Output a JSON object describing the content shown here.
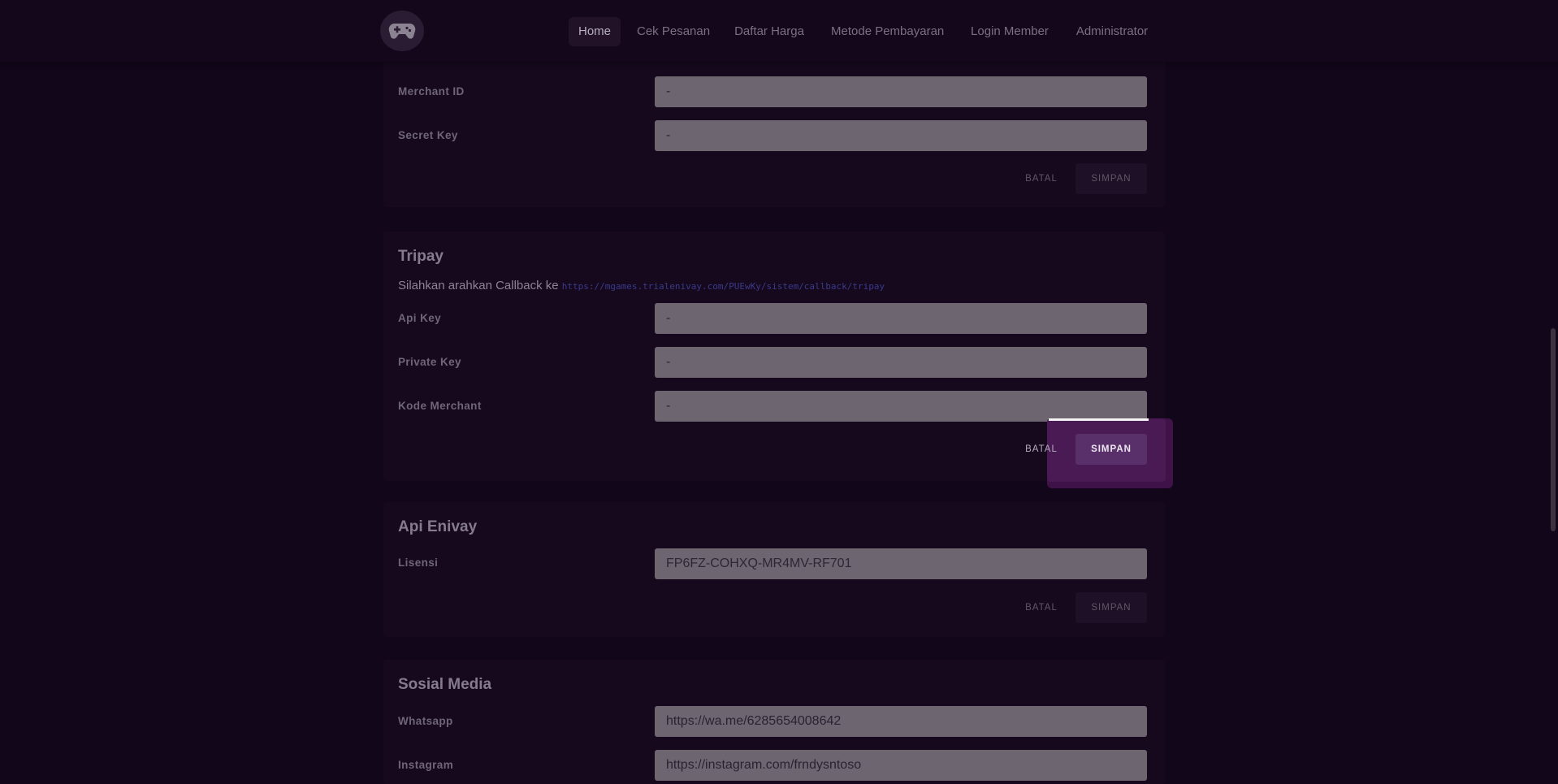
{
  "nav": {
    "logo_icon": "gamepad-icon",
    "items": [
      {
        "label": "Home",
        "active": true
      },
      {
        "label": "Cek Pesanan",
        "active": false
      },
      {
        "label": "Daftar Harga",
        "active": false
      },
      {
        "label": "Metode Pembayaran",
        "active": false
      },
      {
        "label": "Login Member",
        "active": false
      },
      {
        "label": "Administrator",
        "active": false
      }
    ]
  },
  "gateway_top": {
    "fields": [
      {
        "label": "Merchant ID",
        "value": "-"
      },
      {
        "label": "Secret Key",
        "value": "-"
      }
    ],
    "cancel_label": "BATAL",
    "save_label": "SIMPAN"
  },
  "tripay": {
    "title": "Tripay",
    "callback_text": "Silahkan arahkan Callback ke",
    "callback_url": "https://mgames.trialenivay.com/PUEwKy/sistem/callback/tripay",
    "fields": [
      {
        "label": "Api Key",
        "value": "-"
      },
      {
        "label": "Private Key",
        "value": "-"
      },
      {
        "label": "Kode Merchant",
        "value": "-"
      }
    ],
    "cancel_label": "BATAL",
    "save_label": "SIMPAN"
  },
  "api_enivay": {
    "title": "Api Enivay",
    "fields": [
      {
        "label": "Lisensi",
        "value": "FP6FZ-COHXQ-MR4MV-RF701"
      }
    ],
    "cancel_label": "BATAL",
    "save_label": "SIMPAN"
  },
  "sosial_media": {
    "title": "Sosial Media",
    "fields": [
      {
        "label": "Whatsapp",
        "value": "https://wa.me/6285654008642"
      },
      {
        "label": "Instagram",
        "value": "https://instagram.com/frndysntoso"
      }
    ]
  },
  "colors": {
    "background": "#12061a",
    "card": "#16091e",
    "field": "#6d6670",
    "highlight": "#4a1a55"
  }
}
